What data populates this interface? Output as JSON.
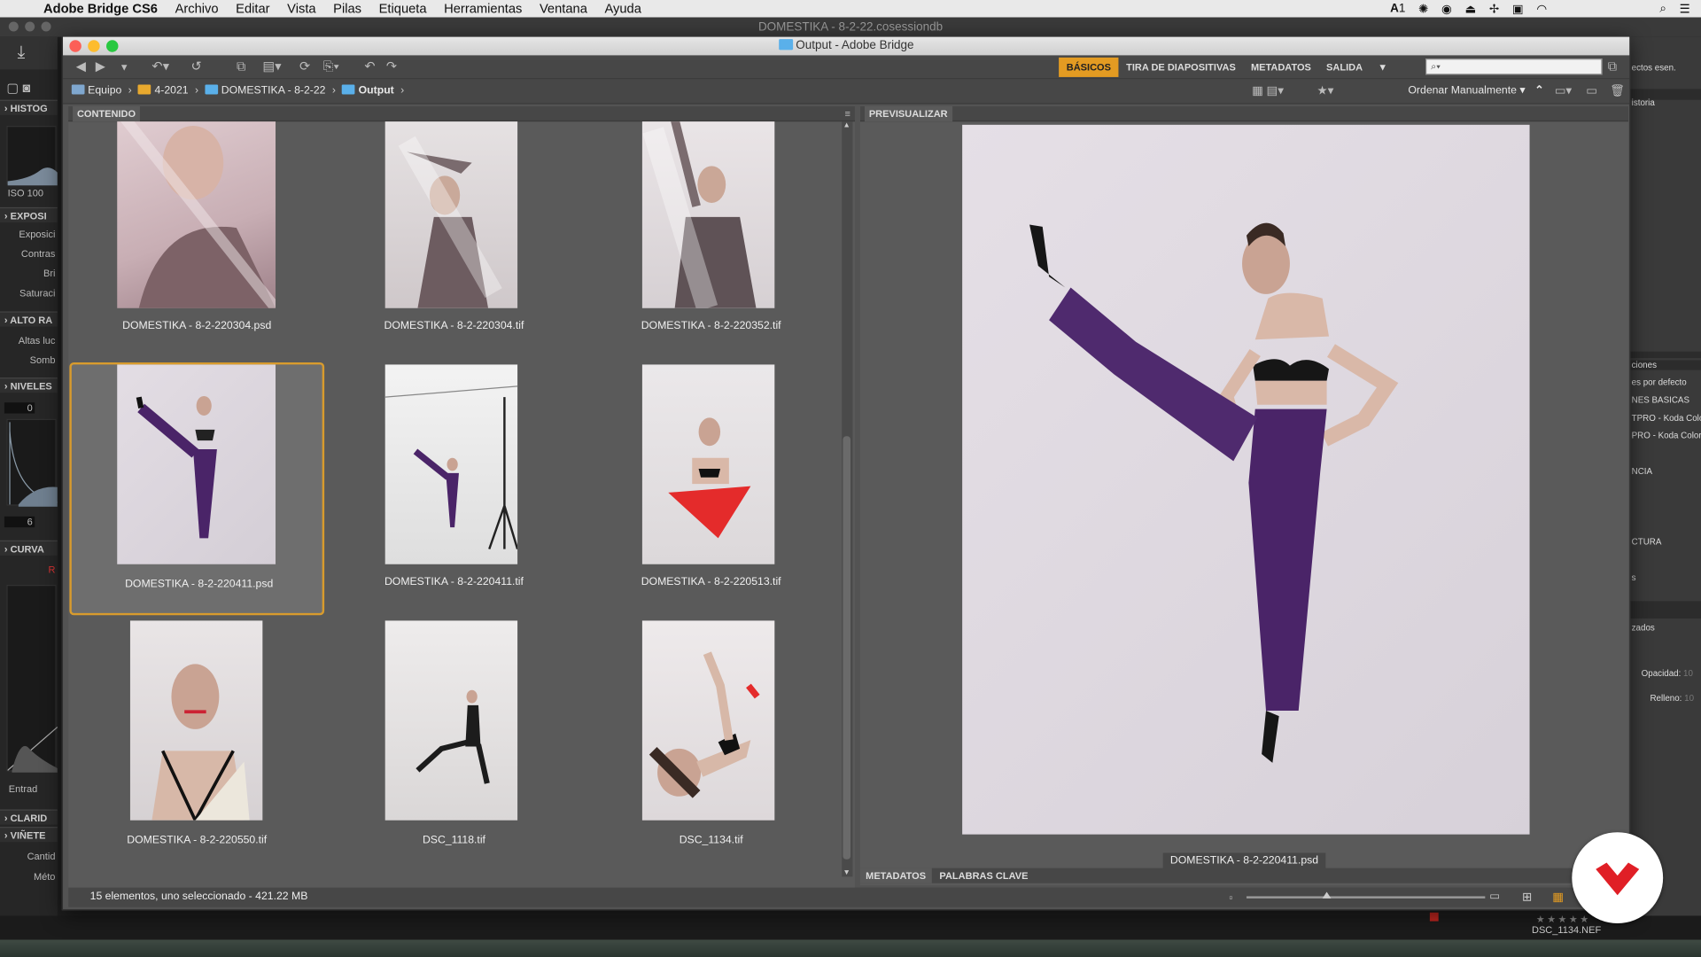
{
  "menubar": {
    "app_name": "Adobe Bridge CS6",
    "items": [
      "Archivo",
      "Editar",
      "Vista",
      "Pilas",
      "Etiqueta",
      "Herramientas",
      "Ventana",
      "Ayuda"
    ],
    "status_num": "1"
  },
  "background_app": {
    "title": "DOMESTIKA - 8-2-22.cosessiondb",
    "left_sections": {
      "histogram": "HISTOG",
      "iso": "ISO 100",
      "exposure": "EXPOSI",
      "exposicion": "Exposici",
      "contraste": "Contras",
      "brillo": "Bri",
      "saturacion": "Saturaci",
      "alto_rango": "ALTO RA",
      "altas_luces": "Altas luc",
      "sombras": "Somb",
      "niveles": "NIVELES",
      "level_top": "0",
      "level_bottom": "6",
      "curva": "CURVA",
      "curva_channel": "R",
      "entrada": "Entrad",
      "claridad": "CLARID",
      "vineta": "VIÑETE",
      "cantidad": "Cantid",
      "metodo": "Méto"
    },
    "right_items": {
      "efectos": "ectos esen.",
      "historia": "istoria",
      "opciones": "ciones",
      "default": "es por defecto",
      "basicas": "NES BASICAS",
      "preset1": "TPRO - Koda Colo",
      "preset2": "PRO - Koda Color",
      "tendencia": "NCIA",
      "estructura": "CTURA",
      "s_item": "s",
      "estilizados": "zados",
      "opacidad": "Opacidad:",
      "opacidad_val": "10",
      "relleno": "Relleno:",
      "relleno_val": "10"
    },
    "bottom_file": "DSC_1134.NEF",
    "bottom_stars": "★★★★★"
  },
  "bridge": {
    "window_title": "Output - Adobe Bridge",
    "workspaces": [
      {
        "label": "BÁSICOS",
        "active": true
      },
      {
        "label": "TIRA DE DIAPOSITIVAS",
        "active": false
      },
      {
        "label": "METADATOS",
        "active": false
      },
      {
        "label": "SALIDA",
        "active": false
      }
    ],
    "search_placeholder": "",
    "breadcrumbs": [
      {
        "label": "Equipo",
        "icon": "computer-icon"
      },
      {
        "label": "4-2021",
        "icon": "folder-icon"
      },
      {
        "label": "DOMESTIKA - 8-2-22",
        "icon": "folder-icon"
      },
      {
        "label": "Output",
        "icon": "folder-icon",
        "bold": true
      }
    ],
    "sort_label": "Ordenar Manualmente",
    "content_tab": "CONTENIDO",
    "preview_tab": "PREVISUALIZAR",
    "files": [
      {
        "name": "DOMESTIKA - 8-2-220304.psd",
        "selected": false,
        "pose": "veil-close"
      },
      {
        "name": "DOMESTIKA - 8-2-220304.tif",
        "selected": false,
        "pose": "veil-arm"
      },
      {
        "name": "DOMESTIKA - 8-2-220352.tif",
        "selected": false,
        "pose": "veil-stand"
      },
      {
        "name": "DOMESTIKA - 8-2-220411.psd",
        "selected": true,
        "pose": "kick"
      },
      {
        "name": "DOMESTIKA - 8-2-220411.tif",
        "selected": false,
        "pose": "kick-studio"
      },
      {
        "name": "DOMESTIKA - 8-2-220513.tif",
        "selected": false,
        "pose": "red-cushion"
      },
      {
        "name": "DOMESTIKA - 8-2-220550.tif",
        "selected": false,
        "pose": "portrait"
      },
      {
        "name": "DSC_1118.tif",
        "selected": false,
        "pose": "lunge"
      },
      {
        "name": "DSC_1134.tif",
        "selected": false,
        "pose": "lying"
      }
    ],
    "preview_caption": "DOMESTIKA - 8-2-220411.psd",
    "bottom_tabs": [
      {
        "label": "METADATOS",
        "active": true
      },
      {
        "label": "PALABRAS CLAVE",
        "active": false
      }
    ],
    "status_text": "15 elementos, uno seleccionado - 421.22 MB",
    "colors": {
      "accent": "#e39b22",
      "selection_border": "#d89b2d",
      "panel": "#5a5a5a",
      "toolbar": "#474747",
      "logo_red": "#e01f26"
    }
  }
}
